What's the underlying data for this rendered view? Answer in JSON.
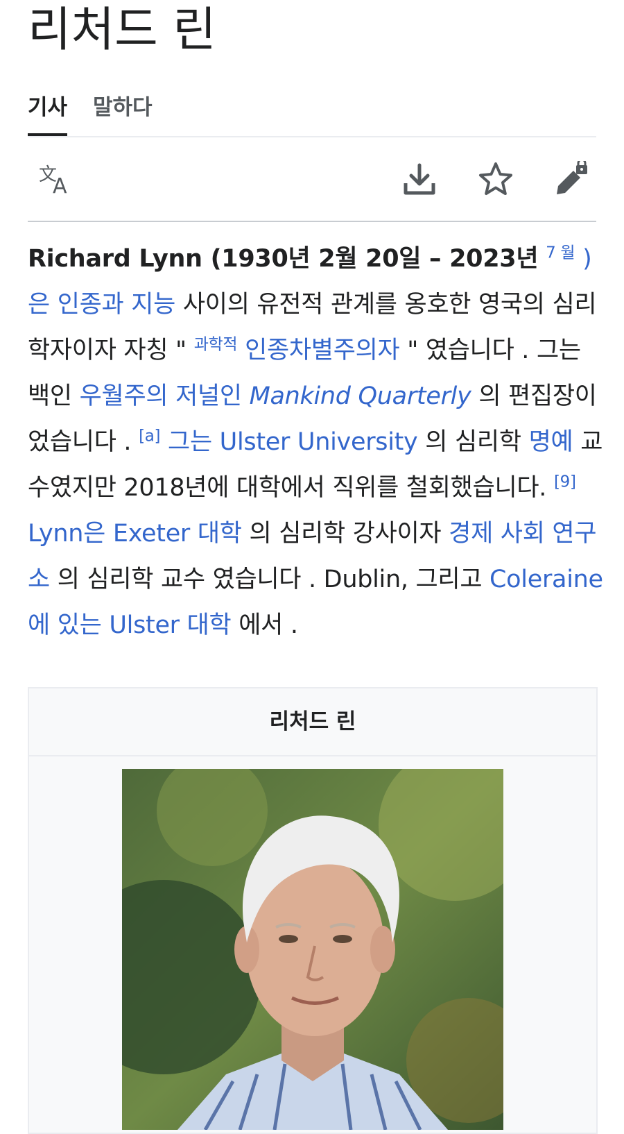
{
  "page": {
    "title": "리처드 린"
  },
  "tabs": [
    {
      "label": "기사",
      "active": true
    },
    {
      "label": "말하다",
      "active": false
    }
  ],
  "toolbar": {
    "icons": [
      "language-icon",
      "download-icon",
      "star-icon",
      "edit-lock-icon"
    ]
  },
  "lead": {
    "name": "Richard Lynn",
    "dates": " (1930년 2월 20일 – 2023년",
    "sup_month": "7 월",
    "close_paren": " )",
    "link_race_iq": "은 인종과 지능",
    "t1": " 사이의 유전적 관계를 옹호한 영국의 심리학자이자 자칭 \" ",
    "sup_scientific": "과학적",
    "link_racist": " 인종차별주의자",
    "t2": " \" 였습니다 . 그는 백인 ",
    "link_supremacist_journal": "우월주의 저널인 ",
    "link_mankind": "Mankind Quarterly",
    "t3": " 의 편집장이었습니다 . ",
    "sup_a": "[a]",
    "link_ulster": " 그는 Ulster University",
    "t4": " 의 심리학 ",
    "link_emeritus": "명예",
    "t5": " 교수였지만 2018년에 대학에서 직위를 철회했습니다. ",
    "sup_9": "[9]",
    "link_exeter": " Lynn은 Exeter 대학",
    "t6": " 의 심리학 강사이자 ",
    "link_esri": "경제 사회 연구소",
    "t7": " 의 심리학 교수 였습니다 . Dublin, 그리고 ",
    "link_coleraine": "Coleraine에 있는 Ulster 대학",
    "t8": " 에서 ."
  },
  "infobox": {
    "title": "리처드 린",
    "image": "portrait-photo"
  },
  "colors": {
    "link": "#3366cc",
    "text": "#202122",
    "divider": "#c8ccd1",
    "infobox_bg": "#f8f9fa"
  }
}
